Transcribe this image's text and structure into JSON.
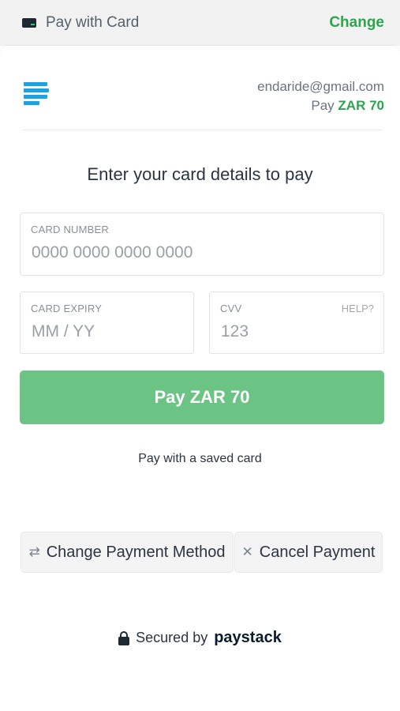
{
  "header": {
    "title": "Pay with Card",
    "change_label": "Change",
    "card_icon": "credit-card-icon"
  },
  "merchant": {
    "logo_icon": "merchant-logo-icon",
    "email": "endaride@gmail.com",
    "pay_prefix": "Pay",
    "amount": "ZAR 70"
  },
  "form": {
    "heading": "Enter your card details to pay",
    "card_number": {
      "label": "CARD NUMBER",
      "placeholder": "0000 0000 0000 0000",
      "value": ""
    },
    "card_expiry": {
      "label": "CARD EXPIRY",
      "placeholder": "MM / YY",
      "value": ""
    },
    "cvv": {
      "label": "CVV",
      "placeholder": "123",
      "value": "",
      "help_label": "HELP?"
    },
    "pay_button_label": "Pay ZAR 70",
    "saved_card_link": "Pay with a saved card"
  },
  "actions": {
    "change_method_label": "Change Payment Method",
    "change_method_icon": "swap-icon",
    "cancel_label": "Cancel Payment",
    "cancel_icon": "close-icon"
  },
  "footer": {
    "secured_text": "Secured by",
    "brand": "paystack",
    "lock_icon": "lock-icon"
  },
  "colors": {
    "accent_green": "#2ea44f",
    "pay_button": "#6cc484",
    "logo_blue": "#1aa3e0"
  }
}
